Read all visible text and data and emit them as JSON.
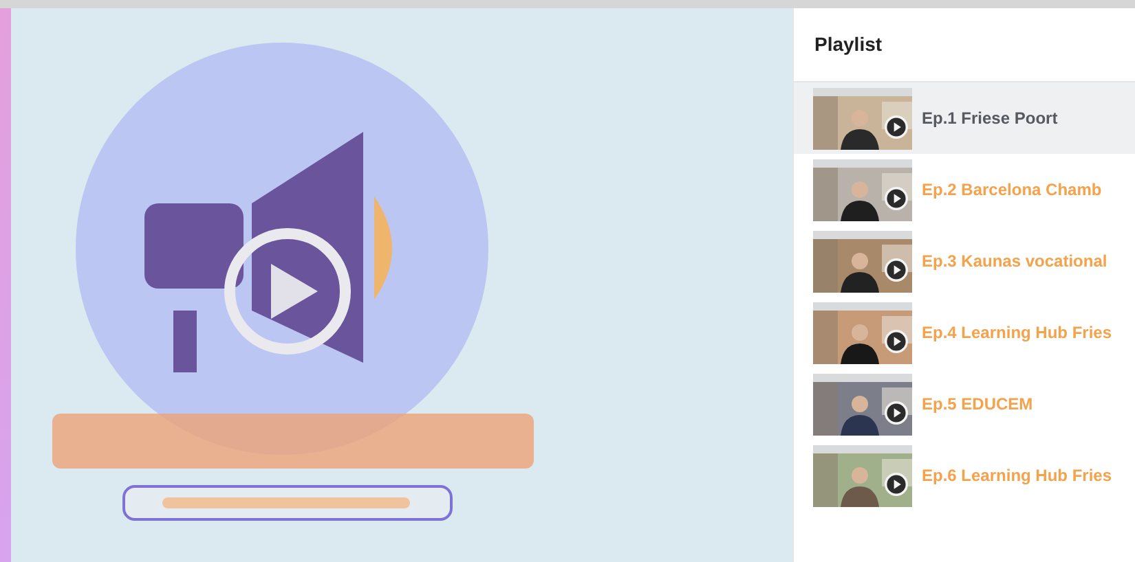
{
  "playlist": {
    "title": "Playlist",
    "items": [
      {
        "title": "Ep.1 Friese Poort",
        "selected": true
      },
      {
        "title": "Ep.2 Barcelona Chamb",
        "selected": false
      },
      {
        "title": "Ep.3 Kaunas vocational",
        "selected": false
      },
      {
        "title": "Ep.4 Learning Hub Fries",
        "selected": false
      },
      {
        "title": "Ep.5 EDUCEM",
        "selected": false
      },
      {
        "title": "Ep.6 Learning Hub Fries",
        "selected": false
      }
    ]
  }
}
